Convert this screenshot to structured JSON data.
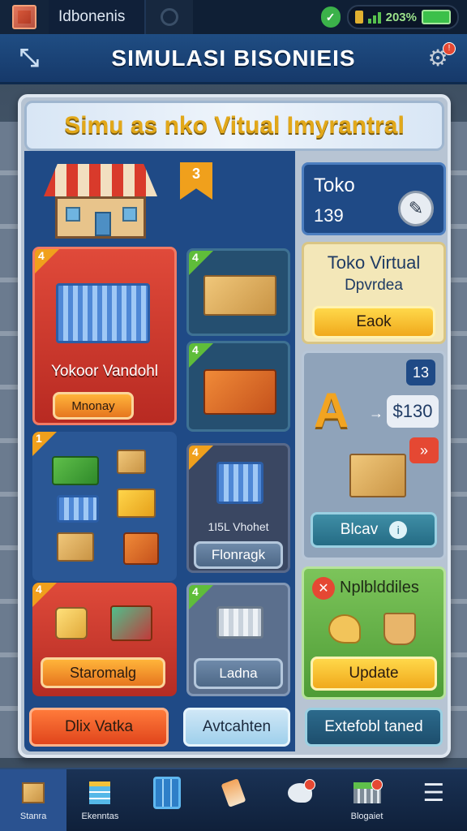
{
  "status_bar": {
    "app_name": "Idbonenis",
    "battery_percent": "203%"
  },
  "header": {
    "title": "SIMULASI BISONIEIS"
  },
  "banner": {
    "title": "Simu as nko Vitual Imyrantral"
  },
  "hero": {
    "badge": "3"
  },
  "store_card": {
    "badge": "4",
    "title": "Yokoor Vandohl",
    "button": "Mnonay"
  },
  "box_card": {
    "badge": "4"
  },
  "crate_card": {
    "badge": "4"
  },
  "products_card": {
    "badge": "1"
  },
  "cart_card": {
    "badge": "4",
    "title": "1I5L Vhohet",
    "button": "Flonragk"
  },
  "toko_info": {
    "title": "Toko",
    "value": "139"
  },
  "toko_virtual": {
    "title": "Toko Virtual",
    "subtitle": "Dpvrdea",
    "button": "Eaok"
  },
  "exchange": {
    "count": "13",
    "letter": "A",
    "arrow": "→",
    "price": "$130",
    "badge_icon": "chevron-right-double",
    "button": "Blcav"
  },
  "upgrades": {
    "title": "Nplblddiles",
    "button": "Update"
  },
  "staging_card": {
    "badge": "4",
    "button": "Staromalg"
  },
  "ladna_card": {
    "badge": "4",
    "button": "Ladna"
  },
  "bottom_buttons": {
    "left": "Dlix Vatka",
    "middle": "Avtcahten",
    "right": "Extefobl taned"
  },
  "nav": {
    "items": [
      {
        "label": "Stanra",
        "icon": "box-icon"
      },
      {
        "label": "Ekenntas",
        "icon": "stack-icon"
      },
      {
        "label": "",
        "icon": "grid-icon"
      },
      {
        "label": "",
        "icon": "eraser-icon"
      },
      {
        "label": "",
        "icon": "hand-icon"
      },
      {
        "label": "Blogaiet",
        "icon": "basket-icon"
      },
      {
        "label": "",
        "icon": "menu-icon"
      }
    ]
  },
  "colors": {
    "accent": "#f0a01c",
    "primary": "#1f4a86",
    "positive": "#5fbd3a",
    "danger": "#e54833"
  }
}
